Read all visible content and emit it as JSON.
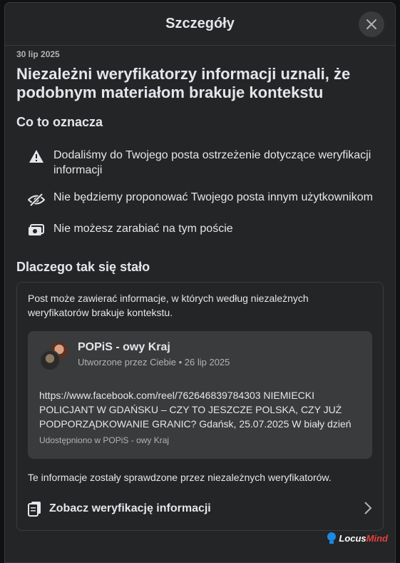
{
  "header": {
    "title": "Szczegóły"
  },
  "date": "30 lip 2025",
  "headline": "Niezależni weryfikatorzy informacji uznali, że podobnym materiałom brakuje kontekstu",
  "meaning": {
    "title": "Co to oznacza",
    "items": [
      {
        "icon": "warning-icon",
        "text": "Dodaliśmy do Twojego posta ostrzeżenie dotyczące weryfikacji informacji"
      },
      {
        "icon": "eye-slash-icon",
        "text": "Nie będziemy proponować Twojego posta innym użytkownikom"
      },
      {
        "icon": "money-off-icon",
        "text": "Nie możesz zarabiać na tym poście"
      }
    ]
  },
  "why": {
    "title": "Dlaczego tak się stało",
    "description": "Post może zawierać informacje, w których według niezależnych weryfikatorów brakuje kontekstu.",
    "post": {
      "name": "POPiS - owy Kraj",
      "subtitle": "Utworzone przez Ciebie • 26 lip 2025",
      "text": "https://www.facebook.com/reel/762646839784303 NIEMIECKI POLICJANT W GDAŃSKU – CZY TO JESZCZE POLSKA, CZY JUŻ PODPORZĄDKOWANIE GRANIC? Gdańsk, 25.07.2025 W biały dzień",
      "shared": "Udostępniono w POPiS - owy Kraj"
    },
    "note": "Te informacje zostały sprawdzone przez niezależnych weryfikatorów.",
    "see_label": "Zobacz weryfikację informacji"
  },
  "watermark": {
    "part1": "Locus",
    "part2": "Mind"
  }
}
